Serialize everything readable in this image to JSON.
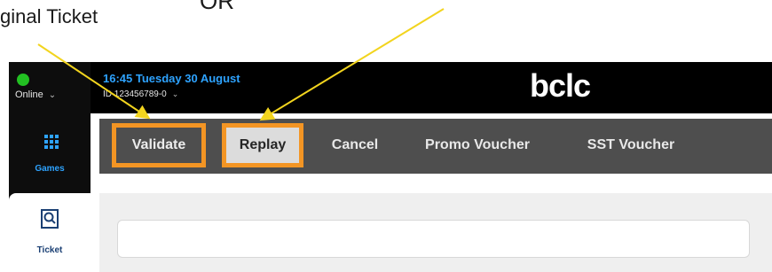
{
  "annotations": {
    "ticket_text": "ginal Ticket",
    "or_text": "OR",
    "arrow_color": "#f2d41e"
  },
  "sidebar": {
    "status": {
      "label": "Online",
      "indicator_color": "#22c022"
    },
    "nav": [
      {
        "label": "Games",
        "icon": "games-grid-icon"
      },
      {
        "label": "Ticket",
        "icon": "ticket-search-icon"
      }
    ]
  },
  "header": {
    "datetime": "16:45 Tuesday 30 August",
    "terminal_id": "ID 123456789-0",
    "logo": "bclc"
  },
  "tabs": [
    {
      "label": "Validate",
      "highlighted": true
    },
    {
      "label": "Replay",
      "highlighted": true,
      "selected": true
    },
    {
      "label": "Cancel"
    },
    {
      "label": "Promo Voucher"
    },
    {
      "label": "SST Voucher"
    }
  ],
  "colors": {
    "accent_blue": "#2ea3ff",
    "highlight_orange": "#f39524",
    "tabbar_bg": "#4e4e4e"
  },
  "ticket_input": {
    "value": ""
  }
}
